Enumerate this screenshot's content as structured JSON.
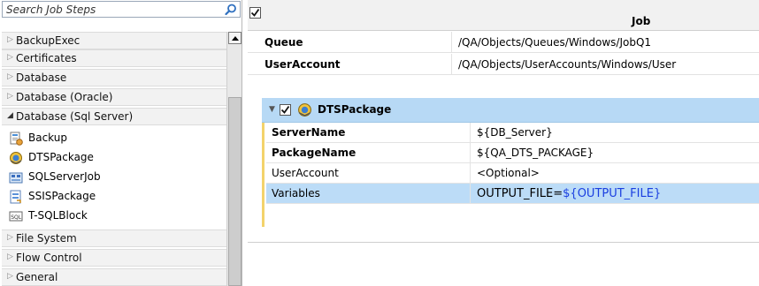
{
  "search": {
    "placeholder": "Search Job Steps"
  },
  "left": {
    "categories": [
      {
        "label": "BackupExec",
        "expanded": false
      },
      {
        "label": "Certificates",
        "expanded": false
      },
      {
        "label": "Database",
        "expanded": false
      },
      {
        "label": "Database (Oracle)",
        "expanded": false
      },
      {
        "label": "Database (Sql Server)",
        "expanded": true
      }
    ],
    "subitems": [
      {
        "label": "Backup",
        "icon": "backup-icon"
      },
      {
        "label": "DTSPackage",
        "icon": "dts-package-icon"
      },
      {
        "label": "SQLServerJob",
        "icon": "sql-server-job-icon"
      },
      {
        "label": "SSISPackage",
        "icon": "ssis-package-icon"
      },
      {
        "label": "T-SQLBlock",
        "icon": "tsql-block-icon"
      }
    ],
    "categories_after": [
      {
        "label": "File System"
      },
      {
        "label": "Flow Control"
      },
      {
        "label": "General"
      }
    ]
  },
  "right": {
    "header_title": "Job",
    "properties": [
      {
        "key": "Queue",
        "value": "/QA/Objects/Queues/Windows/JobQ1"
      },
      {
        "key": "UserAccount",
        "value": "/QA/Objects/UserAccounts/Windows/User"
      }
    ],
    "step": {
      "title": "DTSPackage",
      "rows": [
        {
          "key": "ServerName",
          "value": "${DB_Server}"
        },
        {
          "key": "PackageName",
          "value": "${QA_DTS_PACKAGE}"
        },
        {
          "key": "UserAccount",
          "value": "<Optional>"
        },
        {
          "key": "Variables",
          "value_prefix": "OUTPUT_FILE=",
          "value_var": "${OUTPUT_FILE}"
        }
      ]
    }
  },
  "colors": {
    "step_header_bg": "#b7d9f5",
    "selected_row_bg": "#bcdcf7",
    "accent_bar": "#f3d36b",
    "variable_link": "#1a3fe0"
  }
}
